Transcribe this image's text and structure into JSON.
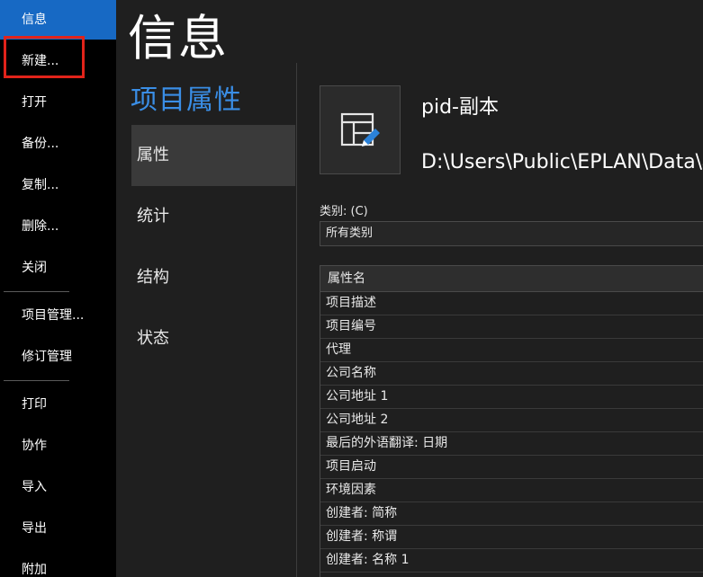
{
  "nav": {
    "items": [
      "信息",
      "新建...",
      "打开",
      "备份...",
      "复制...",
      "删除...",
      "关闭",
      "项目管理...",
      "修订管理",
      "打印",
      "协作",
      "导入",
      "导出",
      "附加"
    ],
    "active_index": 0
  },
  "page_title": "信息",
  "section": {
    "heading": "项目属性",
    "items": [
      "属性",
      "统计",
      "结构",
      "状态"
    ],
    "active_index": 0
  },
  "project": {
    "name": "pid-副本",
    "path": "D:\\Users\\Public\\EPLAN\\Data\\项"
  },
  "category": {
    "label": "类别: (C)",
    "value": "所有类别"
  },
  "properties": {
    "header": "属性名",
    "rows": [
      "项目描述",
      "项目编号",
      "代理",
      "公司名称",
      "公司地址 1",
      "公司地址 2",
      "最后的外语翻译: 日期",
      "项目启动",
      "环境因素",
      "创建者: 简称",
      "创建者: 称谓",
      "创建者: 名称 1"
    ]
  },
  "colors": {
    "accent": "#1769c4",
    "heading_blue": "#3a8ee6",
    "highlight_red": "#e2231a"
  }
}
